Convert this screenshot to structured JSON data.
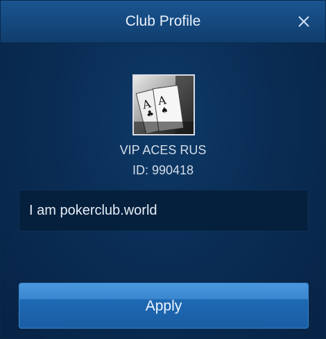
{
  "dialog": {
    "title": "Club Profile",
    "close_icon": "close-icon"
  },
  "club": {
    "name": "VIP ACES RUS",
    "id_text": "ID: 990418",
    "description": "I am pokerclub.world",
    "avatar": "two-aces-cards-image"
  },
  "actions": {
    "apply_label": "Apply"
  },
  "colors": {
    "header": "#15497f",
    "background": "#0a2d55",
    "text_box": "#05203d",
    "button": "#2a74be"
  }
}
